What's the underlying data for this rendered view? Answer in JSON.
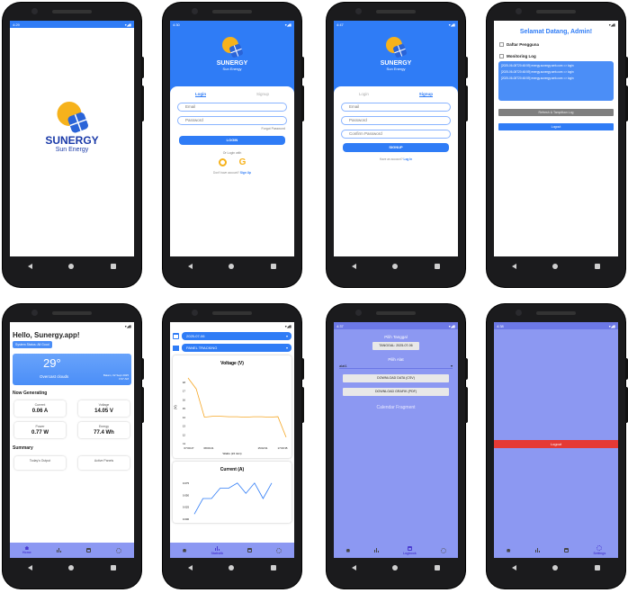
{
  "s1": {
    "status_time": "4:29",
    "brand": "SUNERGY",
    "sub": "Sun Energy"
  },
  "s2": {
    "status_time": "4:30",
    "brand": "SUNERGY",
    "sub": "Sun Energy",
    "tab_login": "Login",
    "tab_signup": "Signup",
    "email_ph": "Email",
    "password_ph": "Password",
    "forgot": "Forgot Password",
    "login_btn": "LOGIN",
    "or": "Or Login with",
    "no_account": "Don't have account?",
    "signup_link": "Sign Up"
  },
  "s3": {
    "status_time": "4:47",
    "brand": "SUNERGY",
    "sub": "Sun Energy",
    "tab_login": "Login",
    "tab_signup": "Signup",
    "email_ph": "Email",
    "password_ph": "Password",
    "confirm_ph": "Confirm Password",
    "signup_btn": "SIGNUP",
    "have_account": "Have an account?",
    "login_link": "Log In"
  },
  "s4": {
    "title": "Selamat Datang, Admin!",
    "daftar": "Daftar Pengguna",
    "monitor": "Monitoring Log",
    "logs": [
      "[2025-06-08T20:48:59] energy.sunergy.web.com => login",
      "[2025-06-08T20:48:59] energy.sunergy.web.com => login",
      "[2025-06-08T20:48:59] energy.sunergy.web.com => login"
    ],
    "btn_logs": "Refresh & Tampilkan Log",
    "btn_logout": "Logout"
  },
  "s5": {
    "greeting": "Hello, Sunergy.app!",
    "badge": "System Status: All Good",
    "temp": "29°",
    "weather": "Overcast clouds",
    "date": "Batam, 02 Sept 2025",
    "time": "3:37 AM",
    "now_gen": "Now Generating",
    "m": [
      {
        "t": "Current",
        "v": "0.06 A"
      },
      {
        "t": "Voltage",
        "v": "14.05 V"
      },
      {
        "t": "Power",
        "v": "0.77 W"
      },
      {
        "t": "Energy",
        "v": "77.4 Wh"
      }
    ],
    "summary": "Summary",
    "sum_left": "Today's Output",
    "sum_right": "Active Panels",
    "tab_home": "Home"
  },
  "s6": {
    "date": "2025-07-06",
    "panel": "PANEL TRACKING",
    "ch1_title": "Voltage (V)",
    "ch1_ylabel": "(V)",
    "ch1_xlabel": "Waktu (24 Jam)",
    "ch1_xticks": [
      "07:00:27",
      "08:00:21",
      "15:02:01",
      "17:00:35"
    ],
    "ch1_yticks": [
      "11",
      "12",
      "13",
      "14",
      "15",
      "16",
      "17",
      "18"
    ],
    "ch2_title": "Current (A)",
    "ch2_yticks": [
      "0.075",
      "0.050",
      "0.025",
      "0.000"
    ],
    "tab_stats": "Statistik",
    "chart_data": [
      {
        "type": "line",
        "title": "Voltage (V)",
        "ylabel": "(V)",
        "xlabel": "Waktu (24 Jam)",
        "ylim": [
          11,
          18.5
        ],
        "values": [
          18.2,
          17.0,
          13.9,
          14.0,
          14.0,
          13.95,
          13.95,
          13.9,
          13.95,
          13.95,
          13.9,
          13.95,
          11.7
        ]
      },
      {
        "type": "line",
        "title": "Current (A)",
        "ylim": [
          0,
          0.08
        ],
        "values": [
          0.01,
          0.04,
          0.04,
          0.06,
          0.06,
          0.07,
          0.05,
          0.07,
          0.04,
          0.07
        ]
      }
    ]
  },
  "s7": {
    "pilih_tanggal": "Pilih Tanggal",
    "tanggal_btn": "TANGGAL: 2025-07-06",
    "pilih_alat": "Pilih Alat",
    "alat": "alat1",
    "dl_csv": "DOWNLOAD DATA (CSV)",
    "dl_pdf": "DOWNLOAD GRAFIK (PDF)",
    "fragment": "Calendar Fragment",
    "tab_logbook": "Logbook"
  },
  "s8": {
    "logout": "Logout",
    "tab_settings": "Settings"
  },
  "colors": {
    "blue": "#2f7cf6",
    "periwinkle": "#8c98f2",
    "red": "#e53935",
    "sun": "#f6b21b"
  }
}
